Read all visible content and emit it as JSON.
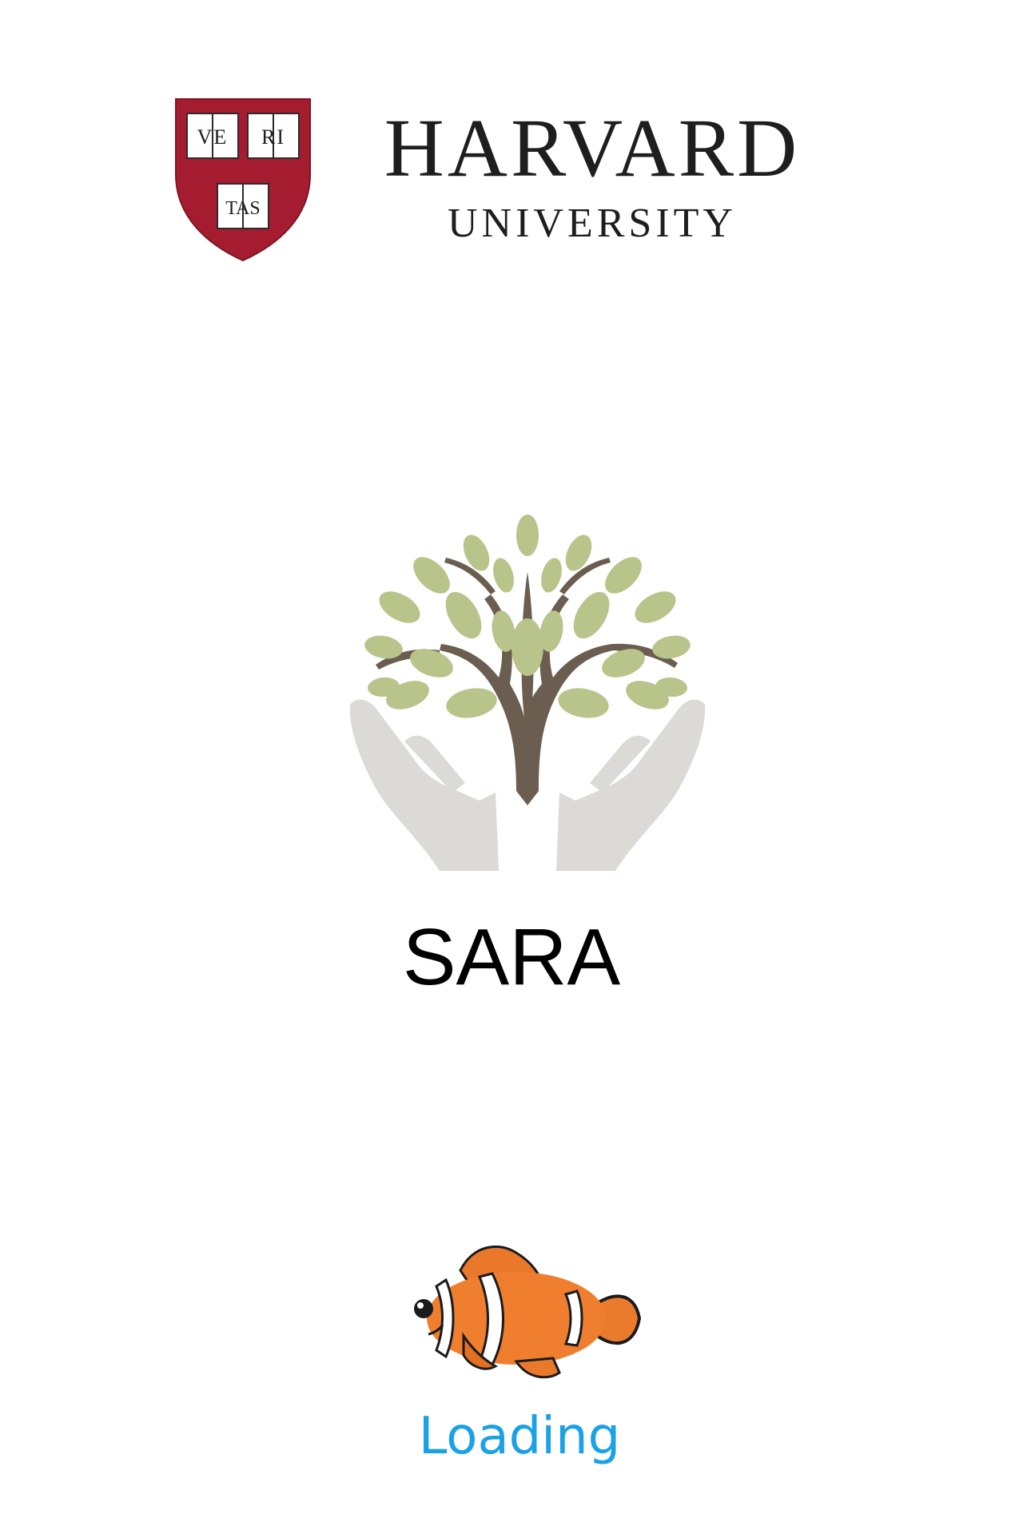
{
  "header": {
    "institution_name": "HARVARD",
    "institution_subtitle": "UNIVERSITY",
    "shield_motto": [
      "VE",
      "RI",
      "TAS"
    ],
    "shield_icon": "harvard-shield-icon",
    "shield_color": "#a51c30"
  },
  "app": {
    "logo_icon": "tree-in-hands-icon",
    "name": "SARA"
  },
  "loading": {
    "mascot_icon": "clownfish-icon",
    "label": "Loading",
    "label_color": "#1aa1e6"
  }
}
